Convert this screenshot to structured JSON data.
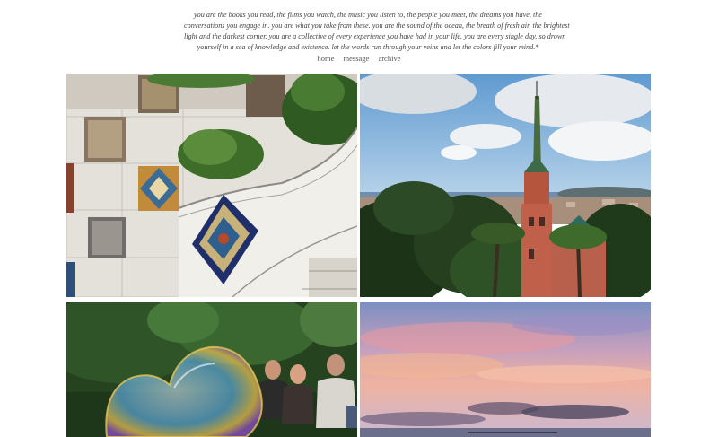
{
  "quote": {
    "lines": [
      "you are the books you read, the films you watch, the music you listen to, the people you meet, the dreams you have, the",
      "conversations you engage in. you are what you take from these. you are the sound of the ocean, the breath of fresh air, the brightest",
      "light and the darkest corner. you are a collective of every experience you have had in your life. you are every single day. so drown",
      "yourself in a sea of knowledge and existence. let the words run through your veins and let the colors fill your mind.*"
    ]
  },
  "nav": {
    "home": "home",
    "message": "message",
    "archive": "archive"
  },
  "photos": [
    "mosaic-bench-photo",
    "city-view-tower-photo",
    "soap-bubble-photo",
    "sunset-sky-photo"
  ]
}
